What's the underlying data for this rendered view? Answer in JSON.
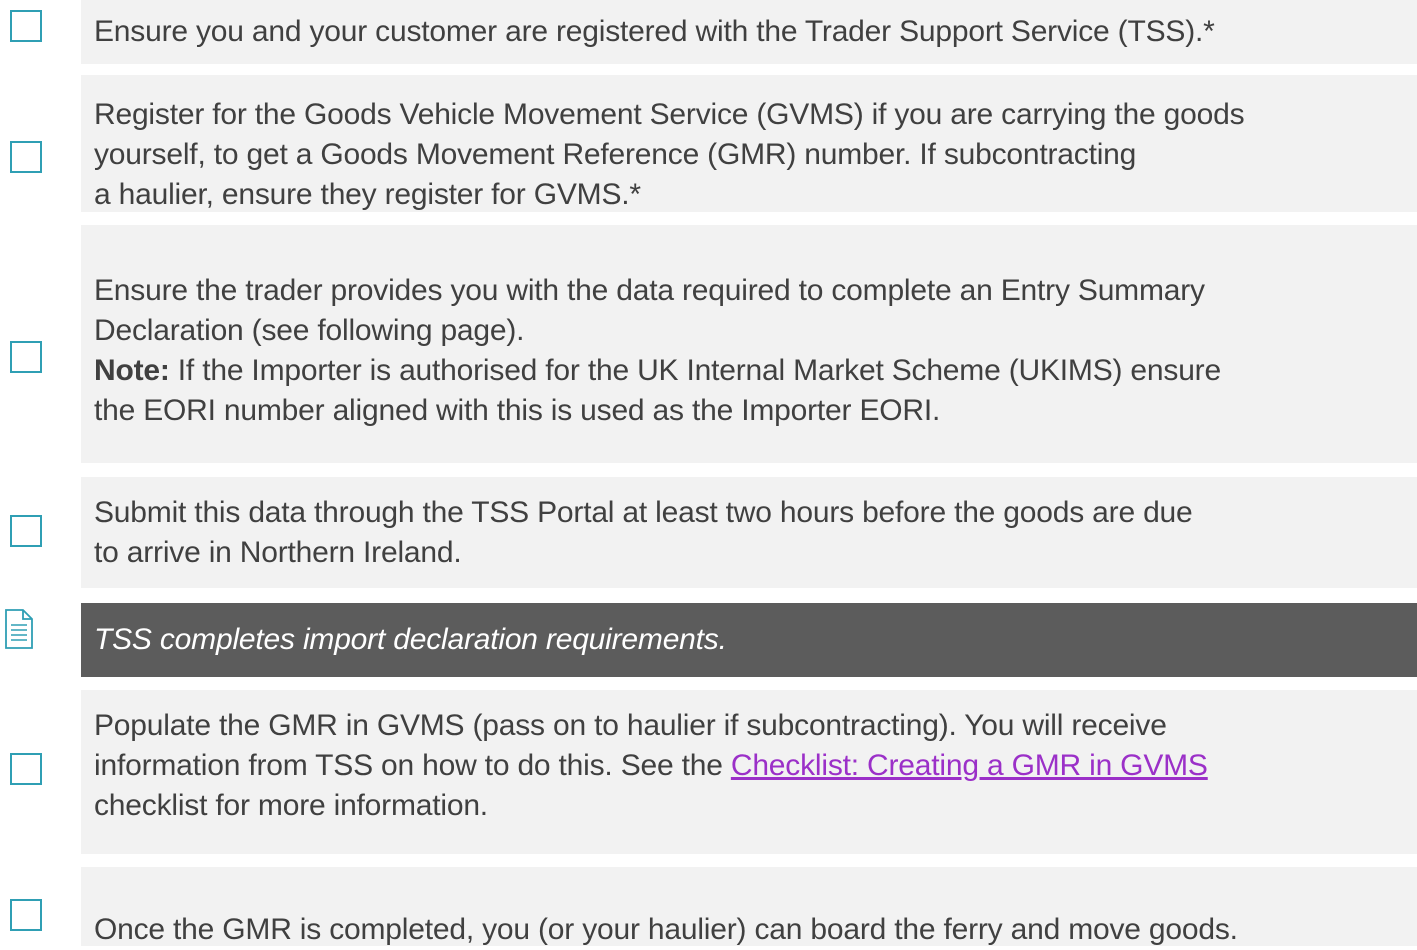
{
  "items": [
    {
      "lines": [
        "Ensure you and your customer are registered with the Trader Support Service (TSS).*"
      ]
    },
    {
      "lines": [
        "Register for the Goods Vehicle Movement Service (GVMS) if you are carrying the goods",
        "yourself, to get a Goods Movement Reference (GMR) number. If subcontracting",
        "a haulier, ensure they register for GVMS.*"
      ]
    },
    {
      "lines": [
        "Ensure the trader provides you with the data required to complete an Entry Summary",
        "Declaration (see following page)."
      ],
      "note_label": "Note:",
      "note_rest": " If the Importer is authorised for the UK Internal Market Scheme (UKIMS) ensure",
      "note_line2": "the EORI number aligned with this is used as the Importer EORI."
    },
    {
      "lines": [
        "Submit this data through the TSS Portal at least two hours before the goods are due",
        "to arrive in Northern Ireland."
      ]
    },
    {
      "banner": "TSS completes import declaration requirements.",
      "icon": "document-icon"
    },
    {
      "line1": "Populate the GMR in GVMS (pass on to haulier if subcontracting). You will receive",
      "line2_prefix": "information from TSS on how to do this. See the ",
      "link": "Checklist: Creating a GMR in GVMS",
      "line3": "checklist for more information."
    },
    {
      "lines": [
        "Once the GMR is completed, you (or your haulier) can board the ferry and move goods."
      ]
    }
  ],
  "colors": {
    "checkbox": "#2f9fb4",
    "panel": "#f2f2f2",
    "banner": "#5c5c5c",
    "text": "#404040",
    "link": "#9b30c8"
  }
}
